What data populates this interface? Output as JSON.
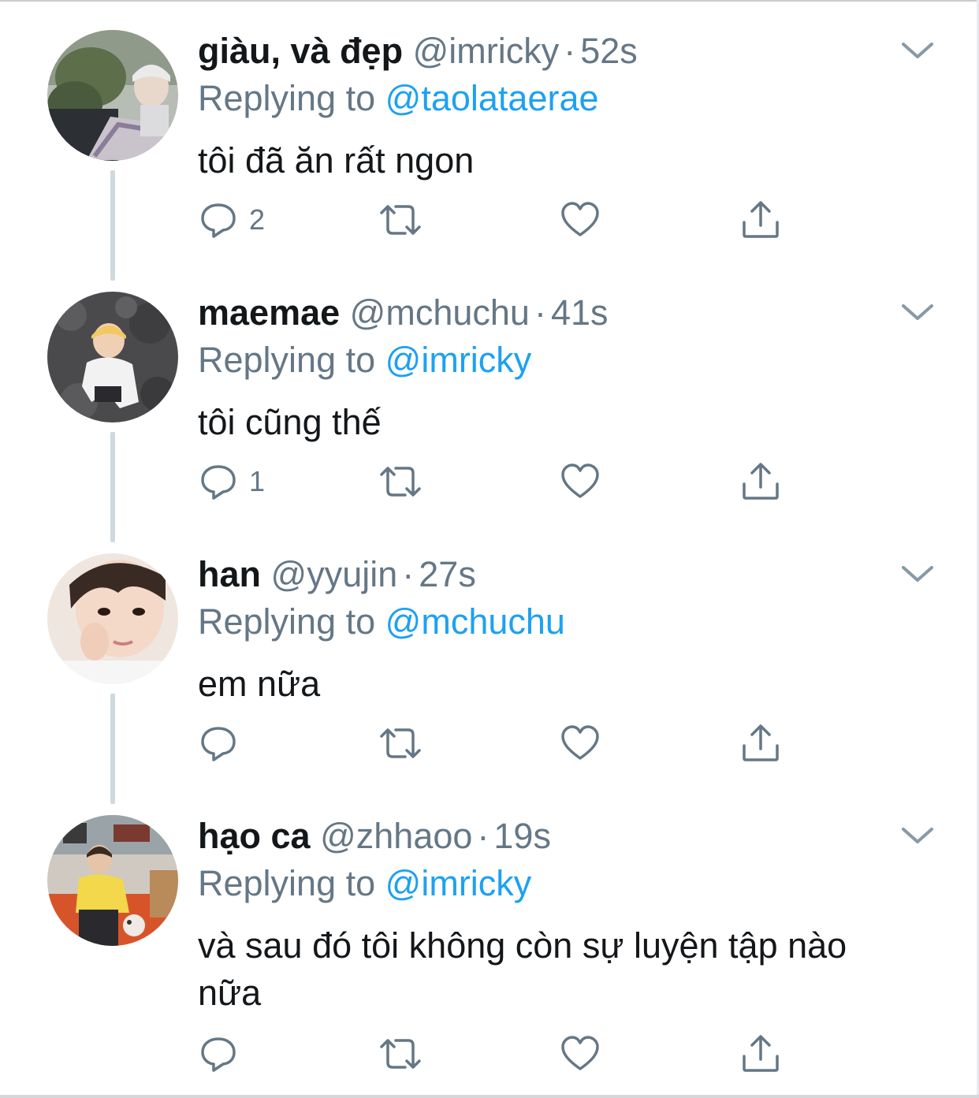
{
  "tweets": [
    {
      "name": "giàu, và đẹp",
      "handle": "@imricky",
      "dot": "·",
      "time": "52s",
      "replying_label": "Replying to",
      "replying_to": "@taolataerae",
      "text": "tôi đã ăn rất ngon",
      "reply_count": "2",
      "avatar_icon": "avatar-photo-plants"
    },
    {
      "name": "maemae",
      "handle": "@mchuchu",
      "dot": "·",
      "time": "41s",
      "replying_label": "Replying to",
      "replying_to": "@imricky",
      "text": "tôi cũng thế",
      "reply_count": "1",
      "avatar_icon": "avatar-photo-rocks"
    },
    {
      "name": "han",
      "handle": "@yyujin",
      "dot": "·",
      "time": "27s",
      "replying_label": "Replying to",
      "replying_to": "@mchuchu",
      "text": "em nữa",
      "reply_count": "",
      "avatar_icon": "avatar-photo-face"
    },
    {
      "name": "hạo ca",
      "handle": "@zhhaoo",
      "dot": "·",
      "time": "19s",
      "replying_label": "Replying to",
      "replying_to": "@imricky",
      "text": "và sau đó tôi không còn sự luyện tập nào nữa",
      "reply_count": "",
      "avatar_icon": "avatar-photo-room"
    }
  ],
  "colors": {
    "text_primary": "#14171a",
    "text_secondary": "#657786",
    "link": "#1da1f2",
    "thread_line": "#cfd9de"
  },
  "icons": [
    "chevron-down-icon",
    "reply-icon",
    "retweet-icon",
    "like-icon",
    "share-icon"
  ]
}
